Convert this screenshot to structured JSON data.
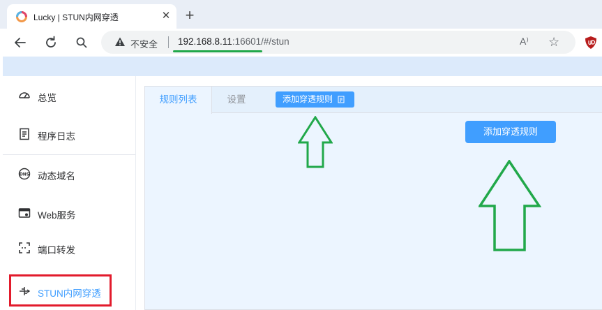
{
  "browser": {
    "tab_title": "Lucky | STUN内网穿透",
    "tab_close": "✕",
    "new_tab": "+",
    "insecure_label": "不安全",
    "url_host": "192.168.8.11",
    "url_rest": ":16601/#/stun",
    "read_aloud": "A⁾",
    "star": "☆"
  },
  "sidebar": {
    "items": [
      {
        "label": "总览",
        "icon": "dashboard-icon"
      },
      {
        "label": "程序日志",
        "icon": "log-icon"
      },
      {
        "label": "动态域名",
        "icon": "dns-icon"
      },
      {
        "label": "Web服务",
        "icon": "web-service-icon"
      },
      {
        "label": "端口转发",
        "icon": "port-forward-icon"
      },
      {
        "label": "STUN内网穿透",
        "icon": "stun-icon",
        "active": true
      }
    ]
  },
  "main": {
    "tabs": [
      {
        "label": "规则列表",
        "active": true
      },
      {
        "label": "设置",
        "active": false
      }
    ],
    "add_rule_small": "添加穿透规则",
    "add_rule_large": "添加穿透规则"
  },
  "colors": {
    "accent": "#409eff",
    "annotation_arrow": "#21a84a",
    "annotation_box": "#e21b2c"
  }
}
